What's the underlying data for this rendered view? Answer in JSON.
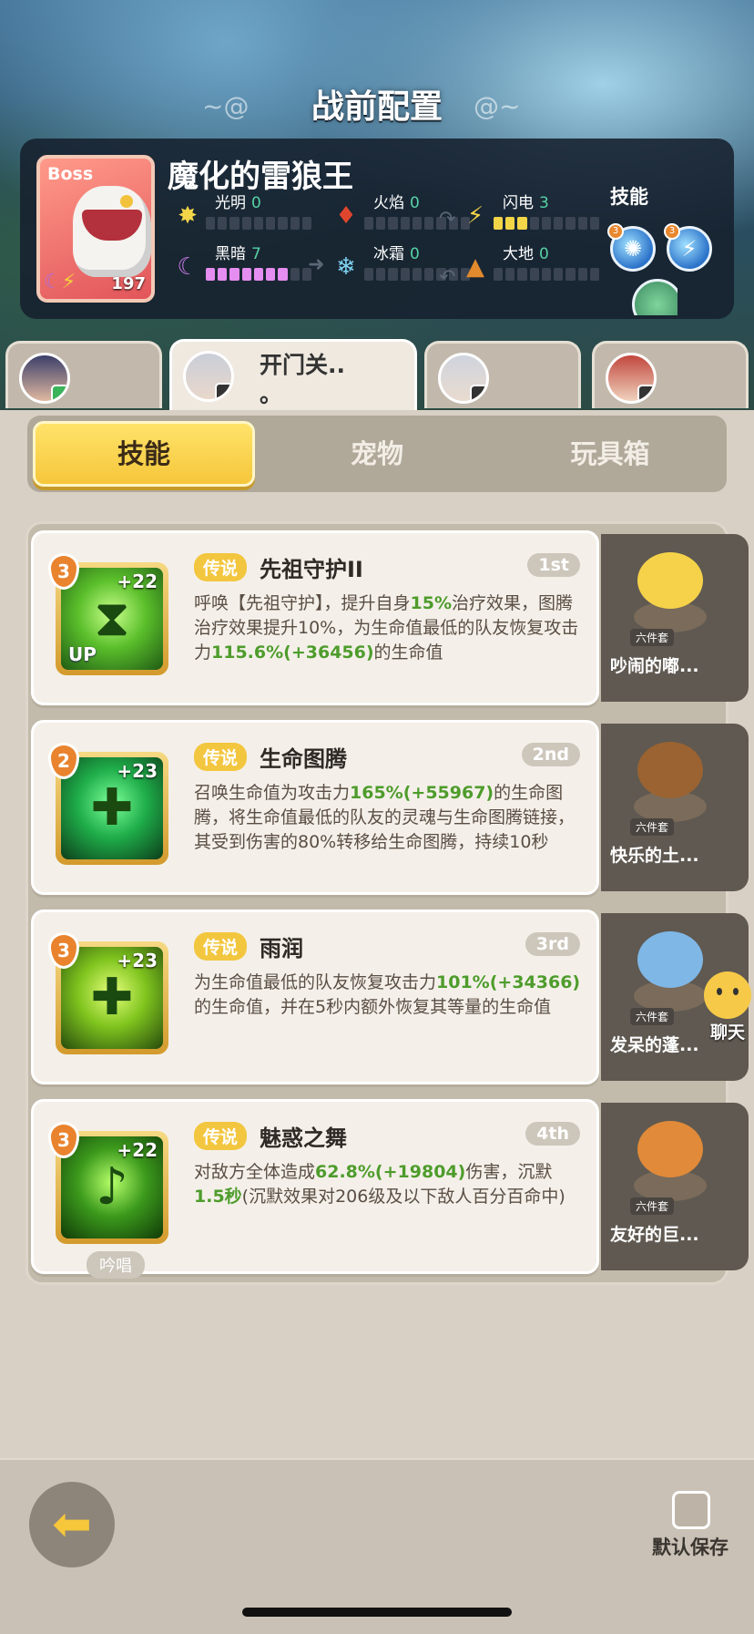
{
  "page": {
    "title": "战前配置"
  },
  "boss": {
    "tag": "Boss",
    "name": "魔化的雷狼王",
    "level": "197",
    "skills_label": "技能",
    "elements": [
      {
        "name": "光明",
        "value": "0",
        "icon": "sun-icon",
        "filled": 0
      },
      {
        "name": "火焰",
        "value": "0",
        "icon": "flame-icon",
        "filled": 0
      },
      {
        "name": "闪电",
        "value": "3",
        "icon": "lightning-icon",
        "filled": 3
      },
      {
        "name": "黑暗",
        "value": "7",
        "icon": "moon-icon",
        "filled": 7
      },
      {
        "name": "冰霜",
        "value": "0",
        "icon": "snowflake-icon",
        "filled": 0
      },
      {
        "name": "大地",
        "value": "0",
        "icon": "mountain-icon",
        "filled": 0
      }
    ]
  },
  "hero_tabs": [
    {
      "name": ""
    },
    {
      "name": "开门关..\n。"
    },
    {
      "name": ""
    },
    {
      "name": ""
    }
  ],
  "sub_tabs": [
    "技能",
    "宠物",
    "玩具箱"
  ],
  "skills": [
    {
      "level": "3",
      "plus": "+22",
      "tag": "传说",
      "name": "先祖守护II",
      "rank": "1st",
      "icon_label": "UP",
      "desc": [
        "呼唤【先祖守护】，提升自身",
        "15%",
        "治疗效果，图腾治疗效果提升10%，为生命值最低的队友恢复攻击力",
        "115.6%(+36456)",
        "的生命值"
      ],
      "pet": {
        "name": "吵闹的嘟...",
        "set": "六件套"
      }
    },
    {
      "level": "2",
      "plus": "+23",
      "tag": "传说",
      "name": "生命图腾",
      "rank": "2nd",
      "desc": [
        "召唤生命值为攻击力",
        "165%(+55967)",
        "的生命图腾，将生命值最低的队友的灵魂与生命图腾链接，其受到伤害的80%转移给生命图腾，持续10秒",
        "",
        ""
      ],
      "pet": {
        "name": "快乐的土...",
        "set": "六件套"
      }
    },
    {
      "level": "3",
      "plus": "+23",
      "tag": "传说",
      "name": "雨润",
      "rank": "3rd",
      "desc": [
        "为生命值最低的队友恢复攻击力",
        "101%(+34366)",
        "的生命值，并在5秒内额外恢复其等量的生命值",
        "",
        ""
      ],
      "pet": {
        "name": "发呆的蓬...",
        "set": "六件套"
      }
    },
    {
      "level": "3",
      "plus": "+22",
      "tag": "传说",
      "name": "魅惑之舞",
      "rank": "4th",
      "chant": "吟唱",
      "desc": [
        "对敌方全体造成",
        "62.8%(+19804)",
        "伤害，沉默",
        "1.5秒",
        "(沉默效果对206级及以下敌人百分百命中)"
      ],
      "pet": {
        "name": "友好的巨...",
        "set": "六件套"
      }
    }
  ],
  "chat": {
    "label": "聊天"
  },
  "footer": {
    "save_label": "默认保存"
  }
}
